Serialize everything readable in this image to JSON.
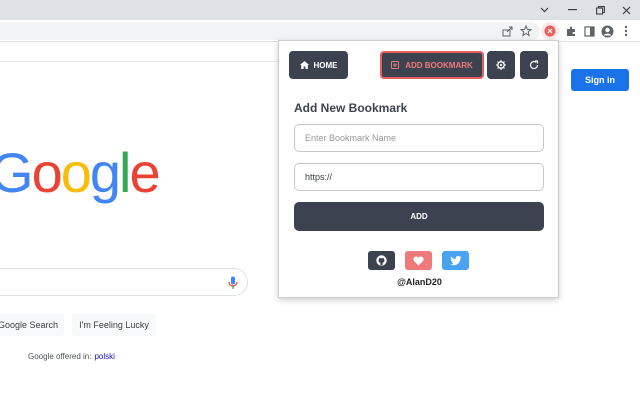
{
  "browser": {
    "window_controls": [
      "chevron-down-icon",
      "minimize-icon",
      "restore-icon",
      "close-icon"
    ],
    "toolbar_icons": [
      "share-icon",
      "star-icon",
      "extension-bookmark-icon",
      "puzzle-icon",
      "sidebar-icon",
      "profile-icon",
      "kebab-menu-icon"
    ]
  },
  "google": {
    "signin_label": "Sign in",
    "logo_letters": [
      "G",
      "o",
      "o",
      "g",
      "l",
      "e"
    ],
    "logo_colors": [
      "#4285f4",
      "#ea4335",
      "#fbbc05",
      "#4285f4",
      "#34a853",
      "#ea4335"
    ],
    "search_button_label": "Google Search",
    "lucky_button_label": "I'm Feeling Lucky",
    "offered_in_text": "Google offered in:",
    "offered_language": "polski"
  },
  "popup": {
    "nav": {
      "home_label": "HOME",
      "add_bookmark_label": "ADD BOOKMARK",
      "settings_icon": "gear-icon",
      "refresh_icon": "refresh-icon"
    },
    "title": "Add New Bookmark",
    "name_field": {
      "placeholder": "Enter Bookmark Name",
      "value": ""
    },
    "url_field": {
      "value": "https://"
    },
    "add_label": "ADD",
    "social": [
      {
        "name": "github",
        "icon": "github-icon",
        "color": "#3c4250"
      },
      {
        "name": "donate",
        "icon": "heart-icon",
        "color": "#f07a7a"
      },
      {
        "name": "twitter",
        "icon": "twitter-icon",
        "color": "#4aa3f0"
      }
    ],
    "author_handle": "@AlanD20"
  },
  "colors": {
    "accent_dark": "#3c4250",
    "accent_red": "#e8605e",
    "google_blue": "#1a73e8"
  }
}
